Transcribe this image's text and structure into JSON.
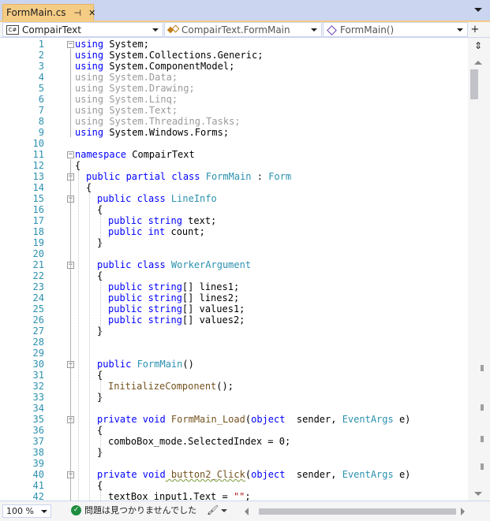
{
  "tab": {
    "title": "FormMain.cs",
    "pin_icon": "pin-icon",
    "close_icon": "close-icon"
  },
  "nav": {
    "project": "CompairText",
    "class": "CompairText.FormMain",
    "member": "FormMain()"
  },
  "code_lines": [
    [
      [
        "kw",
        "using"
      ],
      [
        "",
        "System;"
      ]
    ],
    [
      [
        "kw",
        "using"
      ],
      [
        "",
        "System.Collections.Generic;"
      ]
    ],
    [
      [
        "kw",
        "using"
      ],
      [
        "",
        "System.ComponentModel;"
      ]
    ],
    [
      [
        "gray",
        "using System.Data;"
      ]
    ],
    [
      [
        "gray",
        "using System.Drawing;"
      ]
    ],
    [
      [
        "gray",
        "using System.Linq;"
      ]
    ],
    [
      [
        "gray",
        "using System.Text;"
      ]
    ],
    [
      [
        "gray",
        "using System.Threading.Tasks;"
      ]
    ],
    [
      [
        "kw",
        "using"
      ],
      [
        "",
        "System.Windows.Forms;"
      ]
    ],
    [],
    [
      [
        "kw",
        "namespace"
      ],
      [
        "",
        "CompairText"
      ]
    ],
    [
      [
        "",
        "{"
      ]
    ],
    [
      [
        "kw",
        "public partial class"
      ],
      [
        "ty",
        "FormMain"
      ],
      [
        "",
        " : "
      ],
      [
        "ty",
        "Form"
      ]
    ],
    [
      [
        "",
        "{"
      ]
    ],
    [
      [
        "kw",
        "public class"
      ],
      [
        "ty",
        "LineInfo"
      ]
    ],
    [
      [
        "",
        "{"
      ]
    ],
    [
      [
        "kw",
        "public string"
      ],
      [
        "",
        "text;"
      ]
    ],
    [
      [
        "kw",
        "public int"
      ],
      [
        "",
        "count;"
      ]
    ],
    [
      [
        "",
        "}"
      ]
    ],
    [],
    [
      [
        "kw",
        "public class"
      ],
      [
        "ty",
        "WorkerArgument"
      ]
    ],
    [
      [
        "",
        "{"
      ]
    ],
    [
      [
        "kw",
        "public string"
      ],
      [
        "",
        "[] lines1;"
      ]
    ],
    [
      [
        "kw",
        "public string"
      ],
      [
        "",
        "[] lines2;"
      ]
    ],
    [
      [
        "kw",
        "public string"
      ],
      [
        "",
        "[] values1;"
      ]
    ],
    [
      [
        "kw",
        "public string"
      ],
      [
        "",
        "[] values2;"
      ]
    ],
    [
      [
        "",
        "}"
      ]
    ],
    [],
    [],
    [
      [
        "kw",
        "public"
      ],
      [
        "ty",
        "FormMain"
      ],
      [
        "",
        "()"
      ]
    ],
    [
      [
        "",
        "{"
      ]
    ],
    [
      [
        "fn",
        "InitializeComponent"
      ],
      [
        "",
        "();"
      ]
    ],
    [
      [
        "",
        "}"
      ]
    ],
    [],
    [
      [
        "kw",
        "private void"
      ],
      [
        "fn",
        "FormMain_Load"
      ],
      [
        "",
        "("
      ],
      [
        "kw",
        "object"
      ],
      [
        "",
        " sender, "
      ],
      [
        "ty",
        "EventArgs"
      ],
      [
        "",
        " e)"
      ]
    ],
    [
      [
        "",
        "{"
      ]
    ],
    [
      [
        "",
        "comboBox_mode.SelectedIndex = 0;"
      ]
    ],
    [
      [
        "",
        "}"
      ]
    ],
    [],
    [
      [
        "kw",
        "private void"
      ],
      [
        "fnsq",
        "button2_Click"
      ],
      [
        "",
        "("
      ],
      [
        "kw",
        "object"
      ],
      [
        "",
        " sender, "
      ],
      [
        "ty",
        "EventArgs"
      ],
      [
        "",
        " e)"
      ]
    ],
    [
      [
        "",
        "{"
      ]
    ],
    [
      [
        "",
        "textBox_input1.Text = "
      ],
      [
        "str",
        "\"\""
      ],
      [
        ";"
      ]
    ]
  ],
  "status": {
    "zoom": "100 %",
    "issues": "問題は見つかりませんでした",
    "ok_icon": "check-circle-icon",
    "brush_icon": "code-cleanup-icon"
  }
}
